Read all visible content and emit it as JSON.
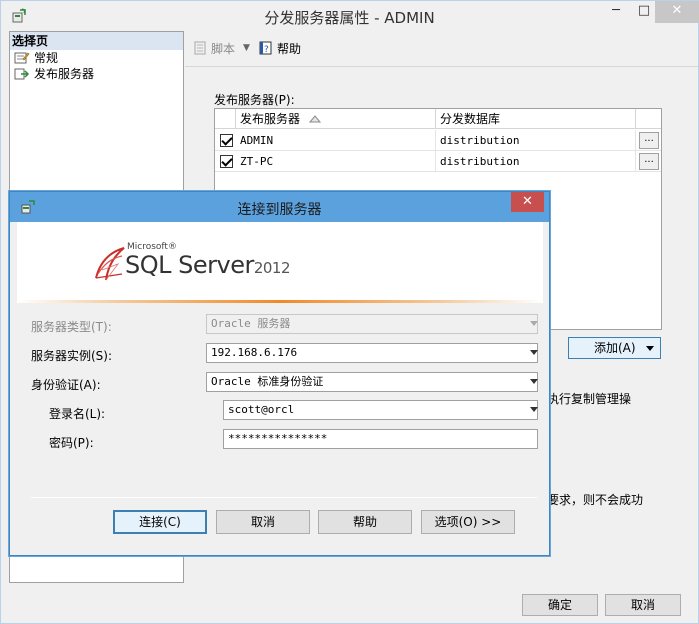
{
  "main_window": {
    "title": "分发服务器属性 - ADMIN",
    "controls": {
      "minimize": "─",
      "maximize": "□",
      "close": "✕"
    },
    "left_panel": {
      "header": "选择页",
      "items": [
        {
          "label": "常规",
          "icon": "properties-icon"
        },
        {
          "label": "发布服务器",
          "icon": "publisher-icon"
        }
      ]
    },
    "toolbar": {
      "script_label": "脚本",
      "help_label": "帮助"
    },
    "publishers_label": "发布服务器(P):",
    "grid": {
      "columns": [
        "发布服务器",
        "分发数据库"
      ],
      "rows": [
        {
          "checked": true,
          "publisher": "ADMIN",
          "database": "distribution",
          "button": "..."
        },
        {
          "checked": true,
          "publisher": "ZT-PC",
          "database": "distribution",
          "button": "..."
        }
      ]
    },
    "add_button": "添加(A)",
    "side_text_1": "执行复制管理操",
    "side_text_2": "要求，则不会成功",
    "ok_button": "确定",
    "cancel_button": "取消"
  },
  "dialog": {
    "title": "连接到服务器",
    "close": "✕",
    "logo": {
      "microsoft": "Microsoft®",
      "product": "SQL Server",
      "year": "2012"
    },
    "fields": {
      "server_type": {
        "label": "服务器类型(T):",
        "value": "Oracle 服务器"
      },
      "server_instance": {
        "label": "服务器实例(S):",
        "value": "192.168.6.176"
      },
      "auth": {
        "label": "身份验证(A):",
        "value": "Oracle 标准身份验证"
      },
      "login": {
        "label": "登录名(L):",
        "value": "scott@orcl"
      },
      "password": {
        "label": "密码(P):",
        "value": "***************"
      }
    },
    "buttons": {
      "connect": "连接(C)",
      "cancel": "取消",
      "help": "帮助",
      "options": "选项(O) >>"
    }
  },
  "colors": {
    "dialog_title_bg": "#5ba1dd",
    "close_button": "#c7504f",
    "banner_accent": "#f08a28",
    "panel_header": "#dbe4f1"
  }
}
